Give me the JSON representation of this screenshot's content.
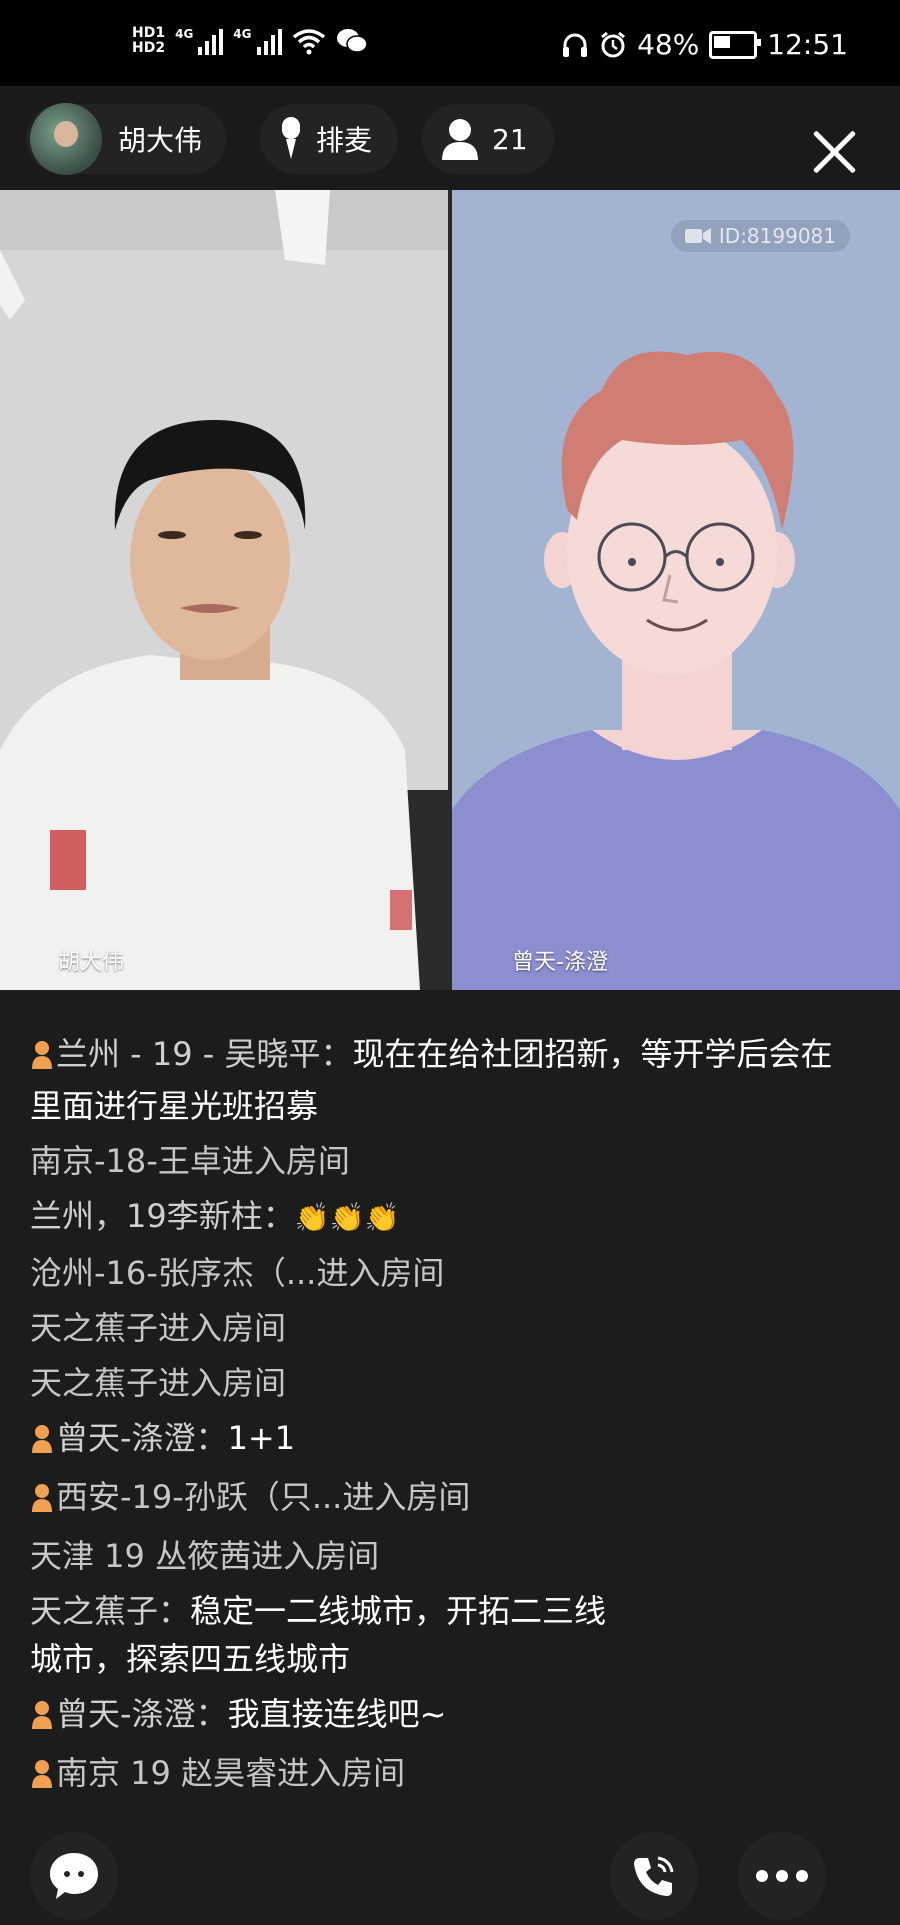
{
  "status_bar": {
    "hd1": "HD1",
    "hd2": "HD2",
    "net1": "4G",
    "net2": "4G",
    "battery": "48%",
    "time": "12:51"
  },
  "room": {
    "host_name": "胡大伟",
    "queue_label": "排麦",
    "viewer_count": "21"
  },
  "videos": {
    "left_name": "胡大伟",
    "right_name": "曾天-涤澄",
    "right_id": "ID:8199081"
  },
  "chat": [
    {
      "from": "兰州 - 19 - 吴晓平：",
      "body": "现在在给社团招新，等开学后会在里面进行星光班招募",
      "badge": true
    },
    {
      "text": "南京-18-王卓进入房间"
    },
    {
      "from": "兰州，19李新柱：",
      "body": "👏👏👏"
    },
    {
      "text": "沧州-16-张序杰（...进入房间"
    },
    {
      "text": "天之蕉子进入房间"
    },
    {
      "text": "天之蕉子进入房间"
    },
    {
      "from": "曾天-涤澄：",
      "body": "1+1",
      "badge": true
    },
    {
      "text": "西安-19-孙跃（只...进入房间",
      "badge": true
    },
    {
      "text": "天津 19 丛筱茜进入房间"
    },
    {
      "from": "天之蕉子：",
      "body": "稳定一二线城市，开拓二三线城市，探索四五线城市"
    },
    {
      "from": "曾天-涤澄：",
      "body": "我直接连线吧~",
      "badge": true
    },
    {
      "text": "南京 19 赵昊睿进入房间",
      "badge": true
    }
  ],
  "colors": {
    "background": "#1c1c1c",
    "badge": "#f0a050",
    "right_video_bg": "#a3b4d2"
  }
}
